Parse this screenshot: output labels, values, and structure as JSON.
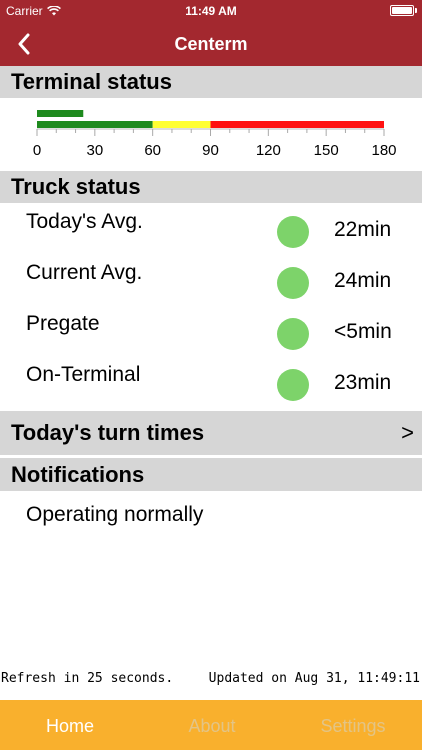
{
  "status_bar": {
    "carrier": "Carrier",
    "time": "11:49 AM"
  },
  "nav": {
    "title": "Centerm"
  },
  "terminal_status": {
    "header": "Terminal status",
    "chart_data": {
      "type": "bar",
      "value": 24,
      "scale_min": 0,
      "scale_max": 180,
      "bands": [
        {
          "from": 0,
          "to": 60,
          "color": "#1e8a1e"
        },
        {
          "from": 60,
          "to": 90,
          "color": "#ffff33"
        },
        {
          "from": 90,
          "to": 180,
          "color": "#ff1111"
        }
      ],
      "tick_labels": [
        "0",
        "30",
        "60",
        "90",
        "120",
        "150",
        "180"
      ],
      "tick_values": [
        0,
        30,
        60,
        90,
        120,
        150,
        180
      ],
      "value_color": "#1e8a1e"
    }
  },
  "truck_status": {
    "header": "Truck status",
    "rows": [
      {
        "label": "Today's Avg.",
        "value": "22min",
        "color": "#7dd36a"
      },
      {
        "label": "Current Avg.",
        "value": "24min",
        "color": "#7dd36a"
      },
      {
        "label": "Pregate",
        "value": "<5min",
        "color": "#7dd36a"
      },
      {
        "label": "On-Terminal",
        "value": "23min",
        "color": "#7dd36a"
      }
    ]
  },
  "turn_times": {
    "label": "Today's turn times",
    "chevron": ">"
  },
  "notifications": {
    "header": "Notifications",
    "text": "Operating normally"
  },
  "footer": {
    "refresh": "Refresh in 25 seconds.",
    "updated": "Updated on Aug 31, 11:49:11"
  },
  "tabs": [
    {
      "label": "Home",
      "active": true
    },
    {
      "label": "About",
      "active": false
    },
    {
      "label": "Settings",
      "active": false
    }
  ],
  "colors": {
    "nav_bg": "#a3282f",
    "tab_bg": "#f9b02d",
    "header_bg": "#d6d6d6"
  }
}
